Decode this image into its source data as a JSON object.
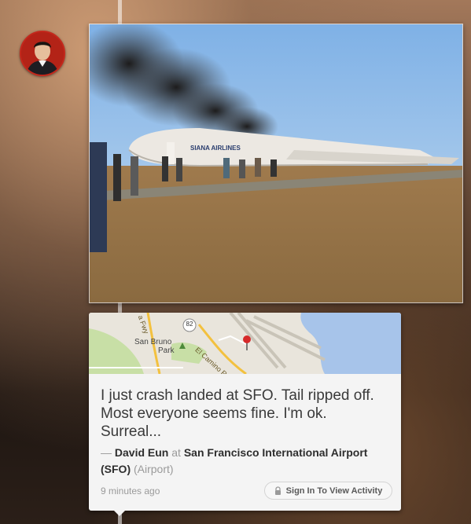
{
  "post": {
    "status_text": "I just crash landed at SFO. Tail ripped off. Most everyone seems fine. I'm ok. Surreal...",
    "author_dash": "— ",
    "author": "David Eun",
    "at_word": " at ",
    "venue": "San Francisco International Airport (SFO)",
    "venue_category": " (Airport)",
    "timestamp": "9 minutes ago",
    "signin_label": "Sign In To View Activity"
  },
  "map": {
    "labels": {
      "city": "San Bruno",
      "park": "Park",
      "road": "El Camino Re",
      "highway": "82",
      "fwy": "a Fwy"
    }
  },
  "photo": {
    "airline_text": "SIANA AIRLINES"
  },
  "icons": {
    "lock": "lock-icon",
    "map_pin": "map-pin-icon",
    "park": "tree-icon"
  },
  "colors": {
    "card_bg": "#f4f4f4",
    "text": "#3a3a3a",
    "muted": "#9a9a9a",
    "water": "#a7c4ea",
    "land": "#e9e5dc",
    "park": "#c8dfa6",
    "highway": "#f3c13f",
    "pin": "#d62a2a"
  }
}
